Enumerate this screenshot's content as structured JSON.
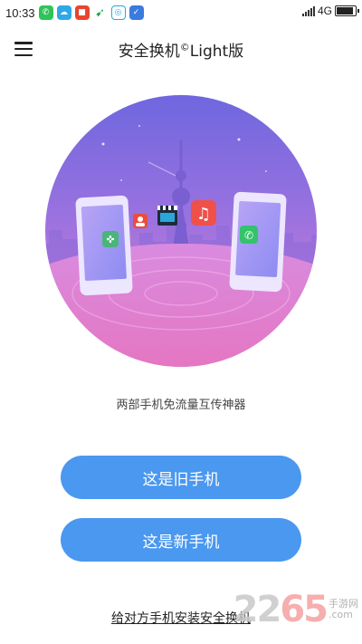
{
  "status_bar": {
    "time": "10:33",
    "network": "4G",
    "battery_level": 0.9
  },
  "header": {
    "title": "安全换机",
    "title_mark": "©",
    "title_suffix": "Light版"
  },
  "illustration": {
    "icons": [
      "game-icon",
      "contact-icon",
      "video-icon",
      "music-icon",
      "phone-call-icon"
    ]
  },
  "tagline": "两部手机免流量互传神器",
  "buttons": {
    "old_phone": "这是旧手机",
    "new_phone": "这是新手机"
  },
  "install_link": "给对方手机安装安全换机",
  "watermark": {
    "number_a": "22",
    "number_b": "65",
    "text": "手游网",
    "domain": ".com"
  }
}
